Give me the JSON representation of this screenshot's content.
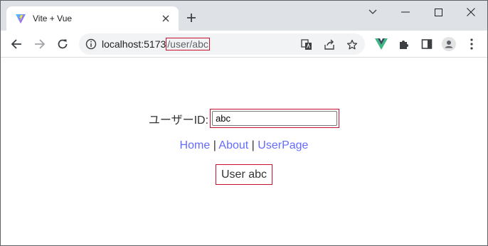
{
  "browser": {
    "tab": {
      "title": "Vite + Vue"
    },
    "address": {
      "host": "localhost:5173",
      "path": "/user/abc"
    }
  },
  "page": {
    "user_id_label": "ユーザーID:",
    "user_id_value": "abc",
    "nav": {
      "home": "Home",
      "about": "About",
      "userpage": "UserPage",
      "separator": "|"
    },
    "user_display": "User abc"
  },
  "colors": {
    "link": "#646cff",
    "highlight": "#c8102e",
    "tabstrip": "#dee1e6"
  }
}
